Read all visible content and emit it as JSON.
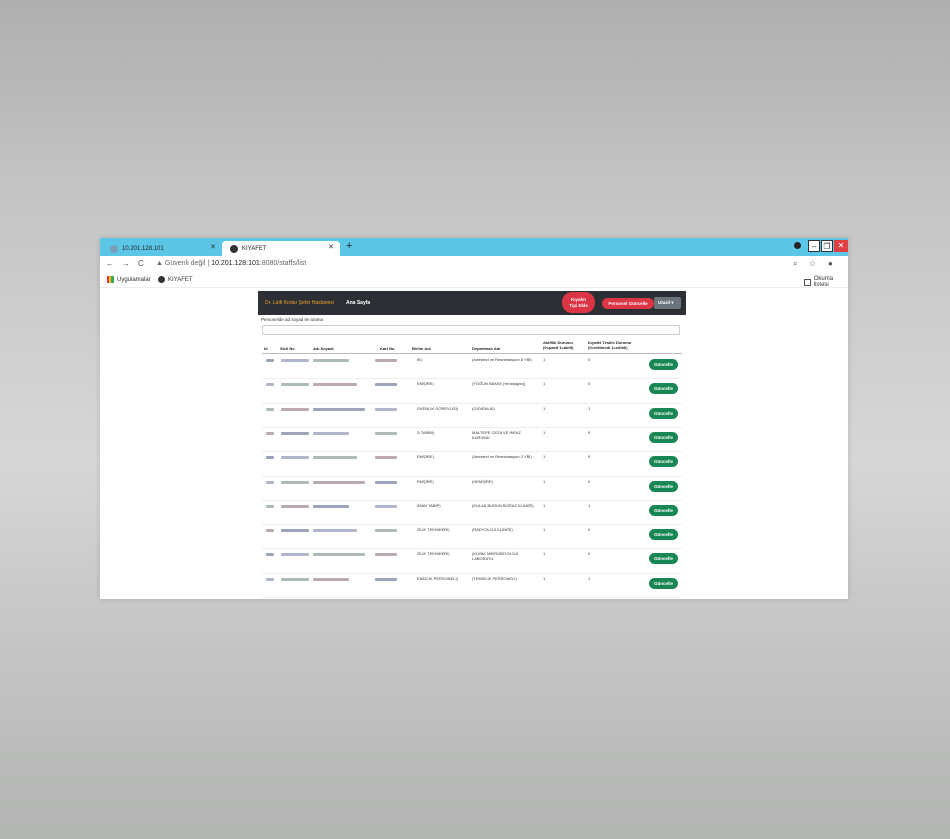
{
  "browser": {
    "tabs": [
      {
        "title": "10.201.128.101",
        "active": false
      },
      {
        "title": "KIYAFET",
        "active": true
      }
    ],
    "new_tab": "+",
    "address": {
      "security": "Güvenli değil",
      "separator": "|",
      "host": "10.201.128.101",
      "path": ":8080/staffs/list"
    },
    "bookmarks": {
      "apps": "Uygulamalar",
      "kiyafet": "KIYAFET",
      "reading_list": "Okuma listesi"
    },
    "nav": {
      "back": "←",
      "forward": "→",
      "reload": "C"
    },
    "right_icons": {
      "zoom": "⌕",
      "star": "☆",
      "profile": "●"
    }
  },
  "navbar": {
    "brand": "Dr. Lütfi Kırdar Şehir Hastanesi",
    "home": "Ana Sayfa",
    "btn_add_type_line1": "Kıyafet",
    "btn_add_type_line2": "Tipi Ekle",
    "btn_update_staff": "Personel Güncelle",
    "btn_utils": "Utazil",
    "btn_utils_caret": "▾"
  },
  "search": {
    "label": "Personelde ad soyad ile arama",
    "placeholder": ""
  },
  "table": {
    "headers": {
      "id": "Id",
      "sicil": "Sicil No",
      "name": "Adı Soyadı",
      "card": "Kart No",
      "unit": "Birlim Adı",
      "dept": "Departman Adı",
      "active_l1": "Aktiflik Durumu",
      "active_l2": "(0=pasif 1=aktif)",
      "delivery_l1": "Kıyafet Teslim Durumu",
      "delivery_l2": "(0=edilmedi 1=edildi)"
    },
    "button_label": "Güncelle",
    "rows": [
      {
        "unit": "İE)",
        "dept": "(Anestezi ve Reanimasyon 8 YBİ)",
        "active": "1",
        "delivery": "0"
      },
      {
        "unit": "EMŞİRE)",
        "dept": "(YOĞUN BAKIM (Yenidoğan))",
        "active": "1",
        "delivery": "0"
      },
      {
        "unit": "ÜVENLİK GÖREVLİSİ)",
        "dept": "(GÜVENLİK)",
        "active": "1",
        "delivery": "1"
      },
      {
        "unit": "S TABİBİ)",
        "dept": "MALTEPE CEZA VE İNFAZ KURUMU",
        "active": "1",
        "delivery": "0"
      },
      {
        "unit": "EMŞİRE)",
        "dept": "(Anestezi ve Reanimasyon 2 YBİ)",
        "active": "1",
        "delivery": "0"
      },
      {
        "unit": "EMŞİRE)",
        "dept": "(HEMŞİRE)",
        "active": "1",
        "delivery": "0"
      },
      {
        "unit": "İMAN TABİP)",
        "dept": "(KULAK BURUN BOĞAZ KLİNİĞİ)",
        "active": "1",
        "delivery": "1"
      },
      {
        "unit": "ĞLIK TEKNİKERİ)",
        "dept": "(RADYOLOJİ KLİNİĞİ)",
        "active": "1",
        "delivery": "0"
      },
      {
        "unit": "ĞLIK TEKNİKERİ)",
        "dept": "(KLİNİK MİKROBİYOLOJİ LABORATU",
        "active": "1",
        "delivery": "0"
      },
      {
        "unit": "EMİZLİK PERSONELİ)",
        "dept": "(TEMİZLİK PERSONELİ)",
        "active": "1",
        "delivery": "1"
      }
    ]
  },
  "colors": {
    "tabbar": "#5cc6e6",
    "navbar": "#2c2f33",
    "brand": "#f0a030",
    "danger": "#dc3545",
    "success": "#198754",
    "secondary": "#6c757d"
  }
}
